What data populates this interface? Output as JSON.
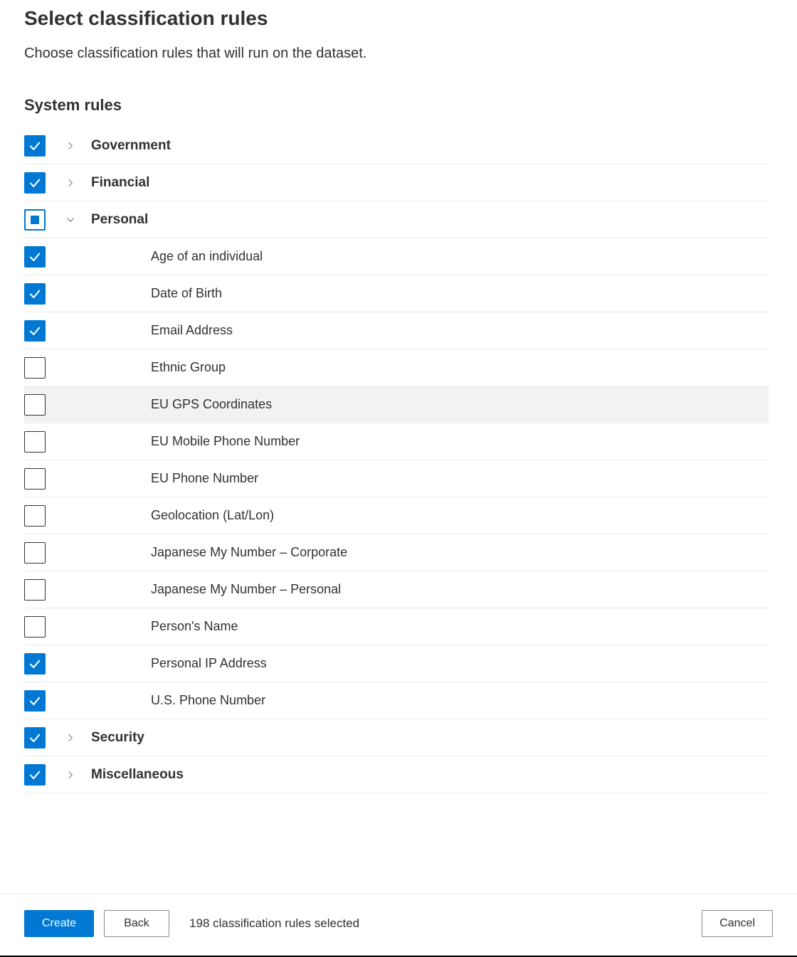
{
  "header": {
    "title": "Select classification rules",
    "subtitle": "Choose classification rules that will run on the dataset."
  },
  "section": {
    "title": "System rules"
  },
  "groups": [
    {
      "id": "government",
      "label": "Government",
      "state": "checked",
      "expanded": false,
      "children": []
    },
    {
      "id": "financial",
      "label": "Financial",
      "state": "checked",
      "expanded": false,
      "children": []
    },
    {
      "id": "personal",
      "label": "Personal",
      "state": "indeterminate",
      "expanded": true,
      "children": [
        {
          "id": "age",
          "label": "Age of an individual",
          "state": "checked"
        },
        {
          "id": "dob",
          "label": "Date of Birth",
          "state": "checked"
        },
        {
          "id": "email",
          "label": "Email Address",
          "state": "checked"
        },
        {
          "id": "ethnic",
          "label": "Ethnic Group",
          "state": "unchecked"
        },
        {
          "id": "eu-gps",
          "label": "EU GPS Coordinates",
          "state": "unchecked",
          "hovered": true
        },
        {
          "id": "eu-mob",
          "label": "EU Mobile Phone Number",
          "state": "unchecked"
        },
        {
          "id": "eu-phone",
          "label": "EU Phone Number",
          "state": "unchecked"
        },
        {
          "id": "geo",
          "label": "Geolocation (Lat/Lon)",
          "state": "unchecked"
        },
        {
          "id": "jp-corp",
          "label": "Japanese My Number – Corporate",
          "state": "unchecked"
        },
        {
          "id": "jp-pers",
          "label": "Japanese My Number – Personal",
          "state": "unchecked"
        },
        {
          "id": "person-name",
          "label": "Person's Name",
          "state": "unchecked"
        },
        {
          "id": "pip",
          "label": "Personal IP Address",
          "state": "checked"
        },
        {
          "id": "us-phone",
          "label": "U.S. Phone Number",
          "state": "checked"
        }
      ]
    },
    {
      "id": "security",
      "label": "Security",
      "state": "checked",
      "expanded": false,
      "children": []
    },
    {
      "id": "miscellaneous",
      "label": "Miscellaneous",
      "state": "checked",
      "expanded": false,
      "children": []
    }
  ],
  "footer": {
    "create_label": "Create",
    "back_label": "Back",
    "cancel_label": "Cancel",
    "status_text": "198 classification rules selected"
  }
}
